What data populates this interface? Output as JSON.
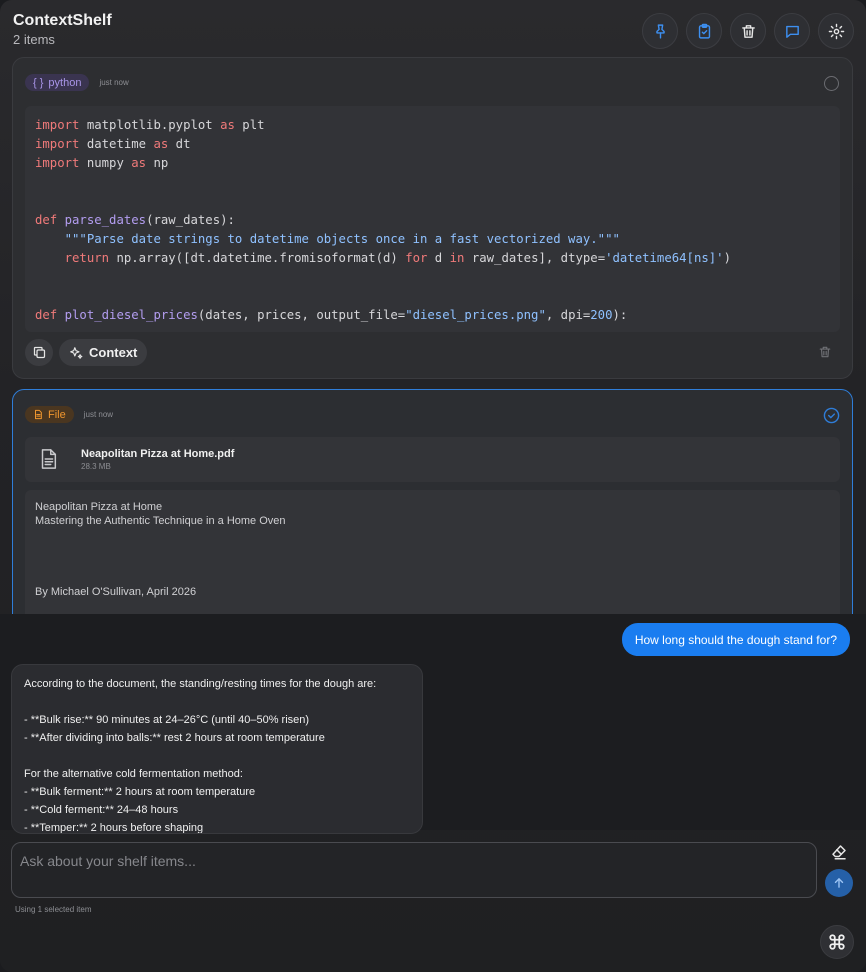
{
  "header": {
    "title": "ContextShelf",
    "item_count": "2 items",
    "buttons": [
      "pin-icon",
      "clipboard-check-icon",
      "trash-icon",
      "chat-icon",
      "gear-icon"
    ]
  },
  "cards": {
    "code": {
      "tag": "python",
      "timestamp": "just now",
      "lines": [
        "import matplotlib.pyplot as plt",
        "import datetime as dt",
        "import numpy as np",
        "",
        "",
        "def parse_dates(raw_dates):",
        "    \"\"\"Parse date strings to datetime objects once in a fast vectorized way.\"\"\"",
        "    return np.array([dt.datetime.fromisoformat(d) for d in raw_dates], dtype='datetime64[ns]')",
        "",
        "",
        "def plot_diesel_prices(dates, prices, output_file=\"diesel_prices.png\", dpi=200):"
      ],
      "context_label": "Context"
    },
    "file": {
      "tag": "File",
      "timestamp": "just now",
      "file_name": "Neapolitan Pizza at Home.pdf",
      "file_size": "28.3 MB",
      "preview": {
        "title": "Neapolitan Pizza at Home",
        "subtitle": "Mastering the Authentic Technique in a Home Oven",
        "author": "By Michael O'Sullivan, April 2026"
      }
    }
  },
  "chat": {
    "user_message": "How long should the dough stand for?",
    "assistant_lines": [
      "According to the document, the standing/resting times for the dough are:",
      "",
      "- **Bulk rise:** 90 minutes at 24–26°C (until 40–50% risen)",
      "- **After dividing into balls:** rest 2 hours at room temperature",
      "",
      "For the alternative cold fermentation method:",
      "- **Bulk ferment:** 2 hours at room temperature",
      "- **Cold ferment:** 24–48 hours",
      "- **Temper:** 2 hours before shaping"
    ]
  },
  "composer": {
    "placeholder": "Ask about your shelf items...",
    "status": "Using 1 selected item"
  },
  "colors": {
    "accent": "#1a7df0",
    "python_tag": "#a995e8",
    "file_tag": "#f0962e"
  }
}
